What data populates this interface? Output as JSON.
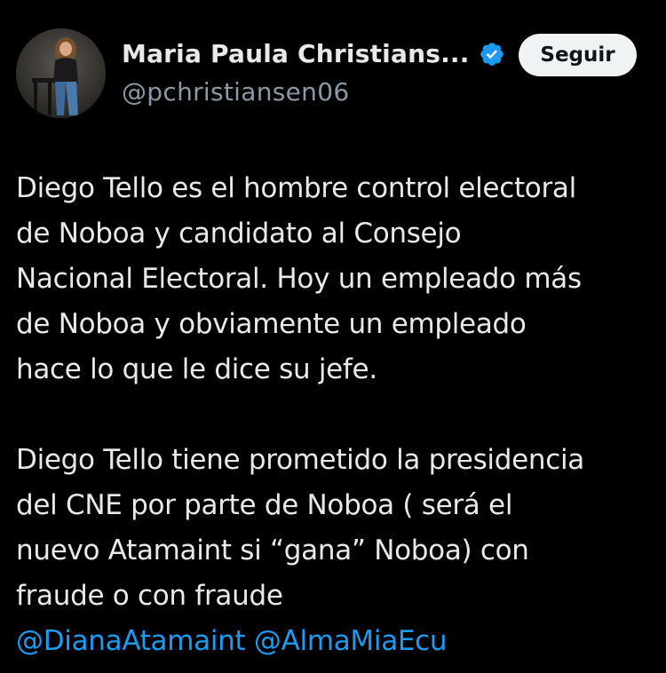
{
  "author": {
    "display_name": "Maria Paula Christians...",
    "handle": "@pchristiansen06",
    "verified_color": "#1d9bf0"
  },
  "actions": {
    "follow_label": "Seguir"
  },
  "tweet": {
    "paragraph1": [
      "Diego Tello es el hombre control electoral",
      "de Noboa y candidato al Consejo",
      "Nacional Electoral. Hoy un empleado más",
      "de Noboa y obviamente un empleado",
      "hace lo que le dice su jefe."
    ],
    "paragraph2": [
      "Diego Tello tiene prometido la presidencia",
      "del CNE por parte de Noboa ( será el",
      "nuevo Atamaint si “gana” Noboa) con",
      "fraude o con fraude"
    ],
    "mentions": [
      "@DianaAtamaint",
      "@AlmaMiaEcu"
    ]
  },
  "icons": {
    "avatar": "profile-photo",
    "verified": "verified-badge-icon"
  },
  "colors": {
    "background": "#000000",
    "text": "#e7e9ea",
    "secondary": "#8b98a5",
    "link": "#1d9bf0",
    "button_bg": "#eff3f4"
  }
}
